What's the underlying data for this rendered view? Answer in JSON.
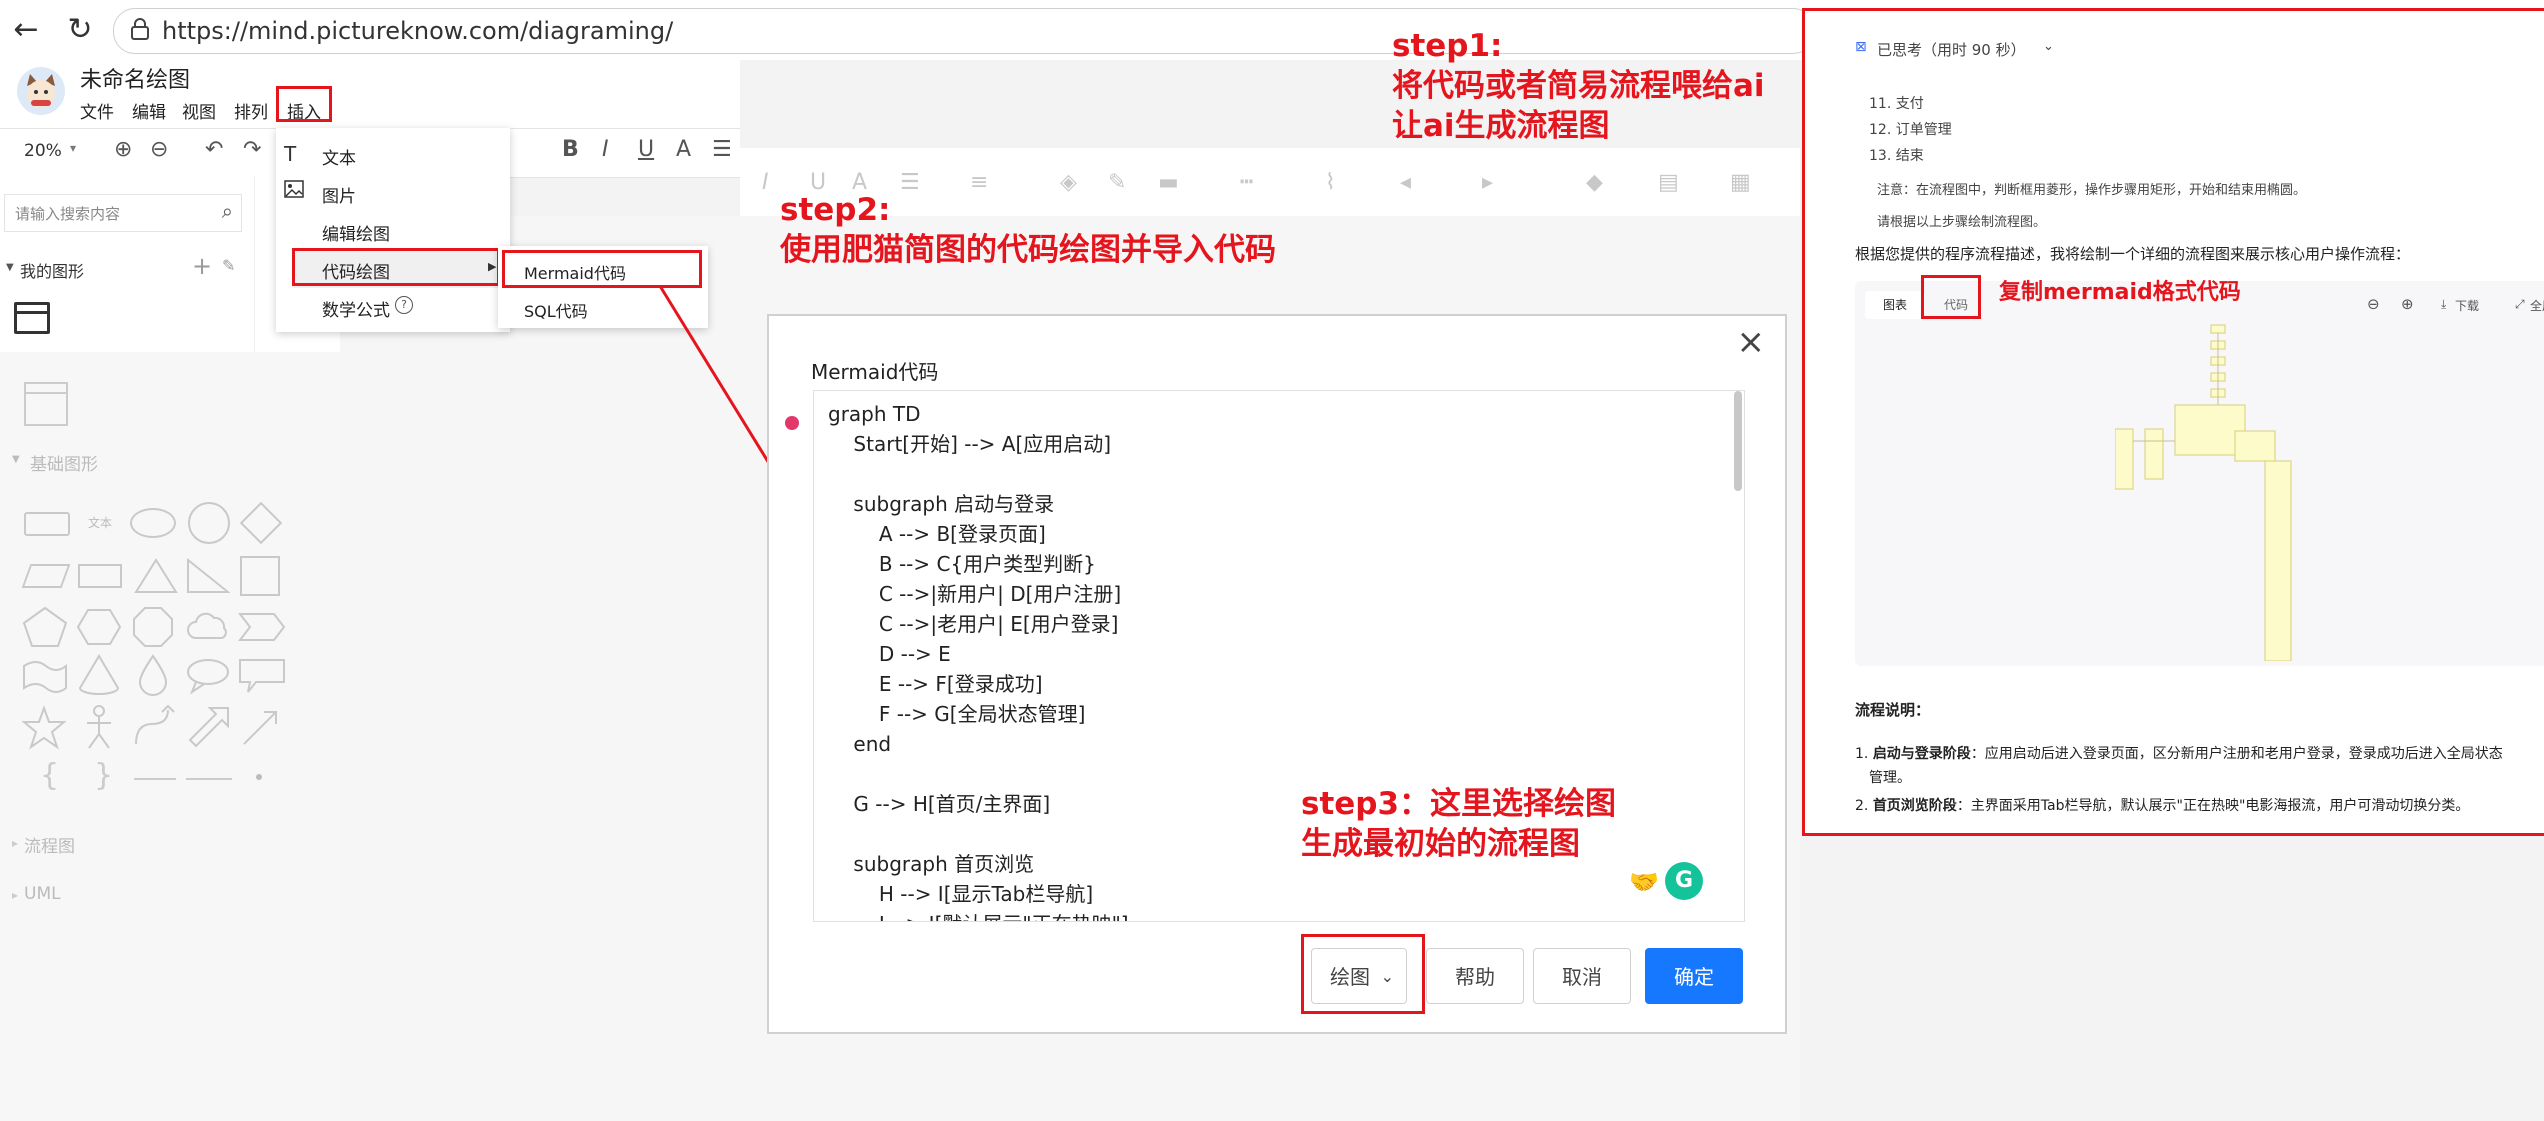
{
  "browser": {
    "url": "https://mind.pictureknow.com/diagraming/"
  },
  "app": {
    "title": "未命名绘图",
    "menu": [
      "文件",
      "编辑",
      "视图",
      "排列",
      "插入"
    ],
    "zoom": "20%",
    "search_placeholder": "请输入搜索内容",
    "my_shapes": "我的图形",
    "basic_shapes": "基础图形",
    "flowchart": "流程图",
    "uml": "UML",
    "shape_text_label": "文本"
  },
  "insert_menu": {
    "items": [
      "文本",
      "图片",
      "编辑绘图",
      "代码绘图",
      "数学公式"
    ],
    "sub_items": [
      "Mermaid代码",
      "SQL代码"
    ]
  },
  "annotations": {
    "step1_title": "step1:",
    "step1_line1": "将代码或者简易流程喂给ai",
    "step1_line2": "让ai生成流程图",
    "step2_title": "step2:",
    "step2_line1": "使用肥猫简图的代码绘图并导入代码",
    "step3_line1": "step3：这里选择绘图",
    "step3_line2": "生成最初始的流程图",
    "copy_note": "复制mermaid格式代码"
  },
  "dialog": {
    "title": "Mermaid代码",
    "code_lines": [
      "graph TD",
      "    Start[开始] --> A[应用启动]",
      "",
      "    subgraph 启动与登录",
      "        A --> B[登录页面]",
      "        B --> C{用户类型判断}",
      "        C -->|新用户| D[用户注册]",
      "        C -->|老用户| E[用户登录]",
      "        D --> E",
      "        E --> F[登录成功]",
      "        F --> G[全局状态管理]",
      "    end",
      "",
      "    G --> H[首页/主界面]",
      "",
      "    subgraph 首页浏览",
      "        H --> I[显示Tab栏导航]",
      "        I --> J[默认展示\"正在热映\"]"
    ],
    "select_value": "绘图",
    "help_label": "帮助",
    "cancel_label": "取消",
    "ok_label": "确定"
  },
  "ai_panel": {
    "thinking": "已思考（用时 90 秒）",
    "list_items": [
      "11. 支付",
      "12. 订单管理",
      "13. 结束"
    ],
    "note": "注意：在流程图中，判断框用菱形，操作步骤用矩形，开始和结束用椭圆。",
    "note2": "请根据以上步骤绘制流程图。",
    "intro": "根据您提供的程序流程描述，我将绘制一个详细的流程图来展示核心用户操作流程：",
    "tab_chart": "图表",
    "tab_code": "代码",
    "download": "下载",
    "fullscreen": "全屏",
    "explain_title": "流程说明：",
    "explain1_bold": "启动与登录阶段",
    "explain1_text": "：应用启动后进入登录页面，区分新用户注册和老用户登录，登录成功后进入全局状态",
    "explain1_cont": "管理。",
    "explain2_bold": "首页浏览阶段",
    "explain2_text": "：主界面采用Tab栏导航，默认展示\"正在热映\"电影海报流，用户可滑动切换分类。"
  },
  "colors": {
    "annotation_red": "#e5151e",
    "primary_blue": "#1677ff"
  }
}
